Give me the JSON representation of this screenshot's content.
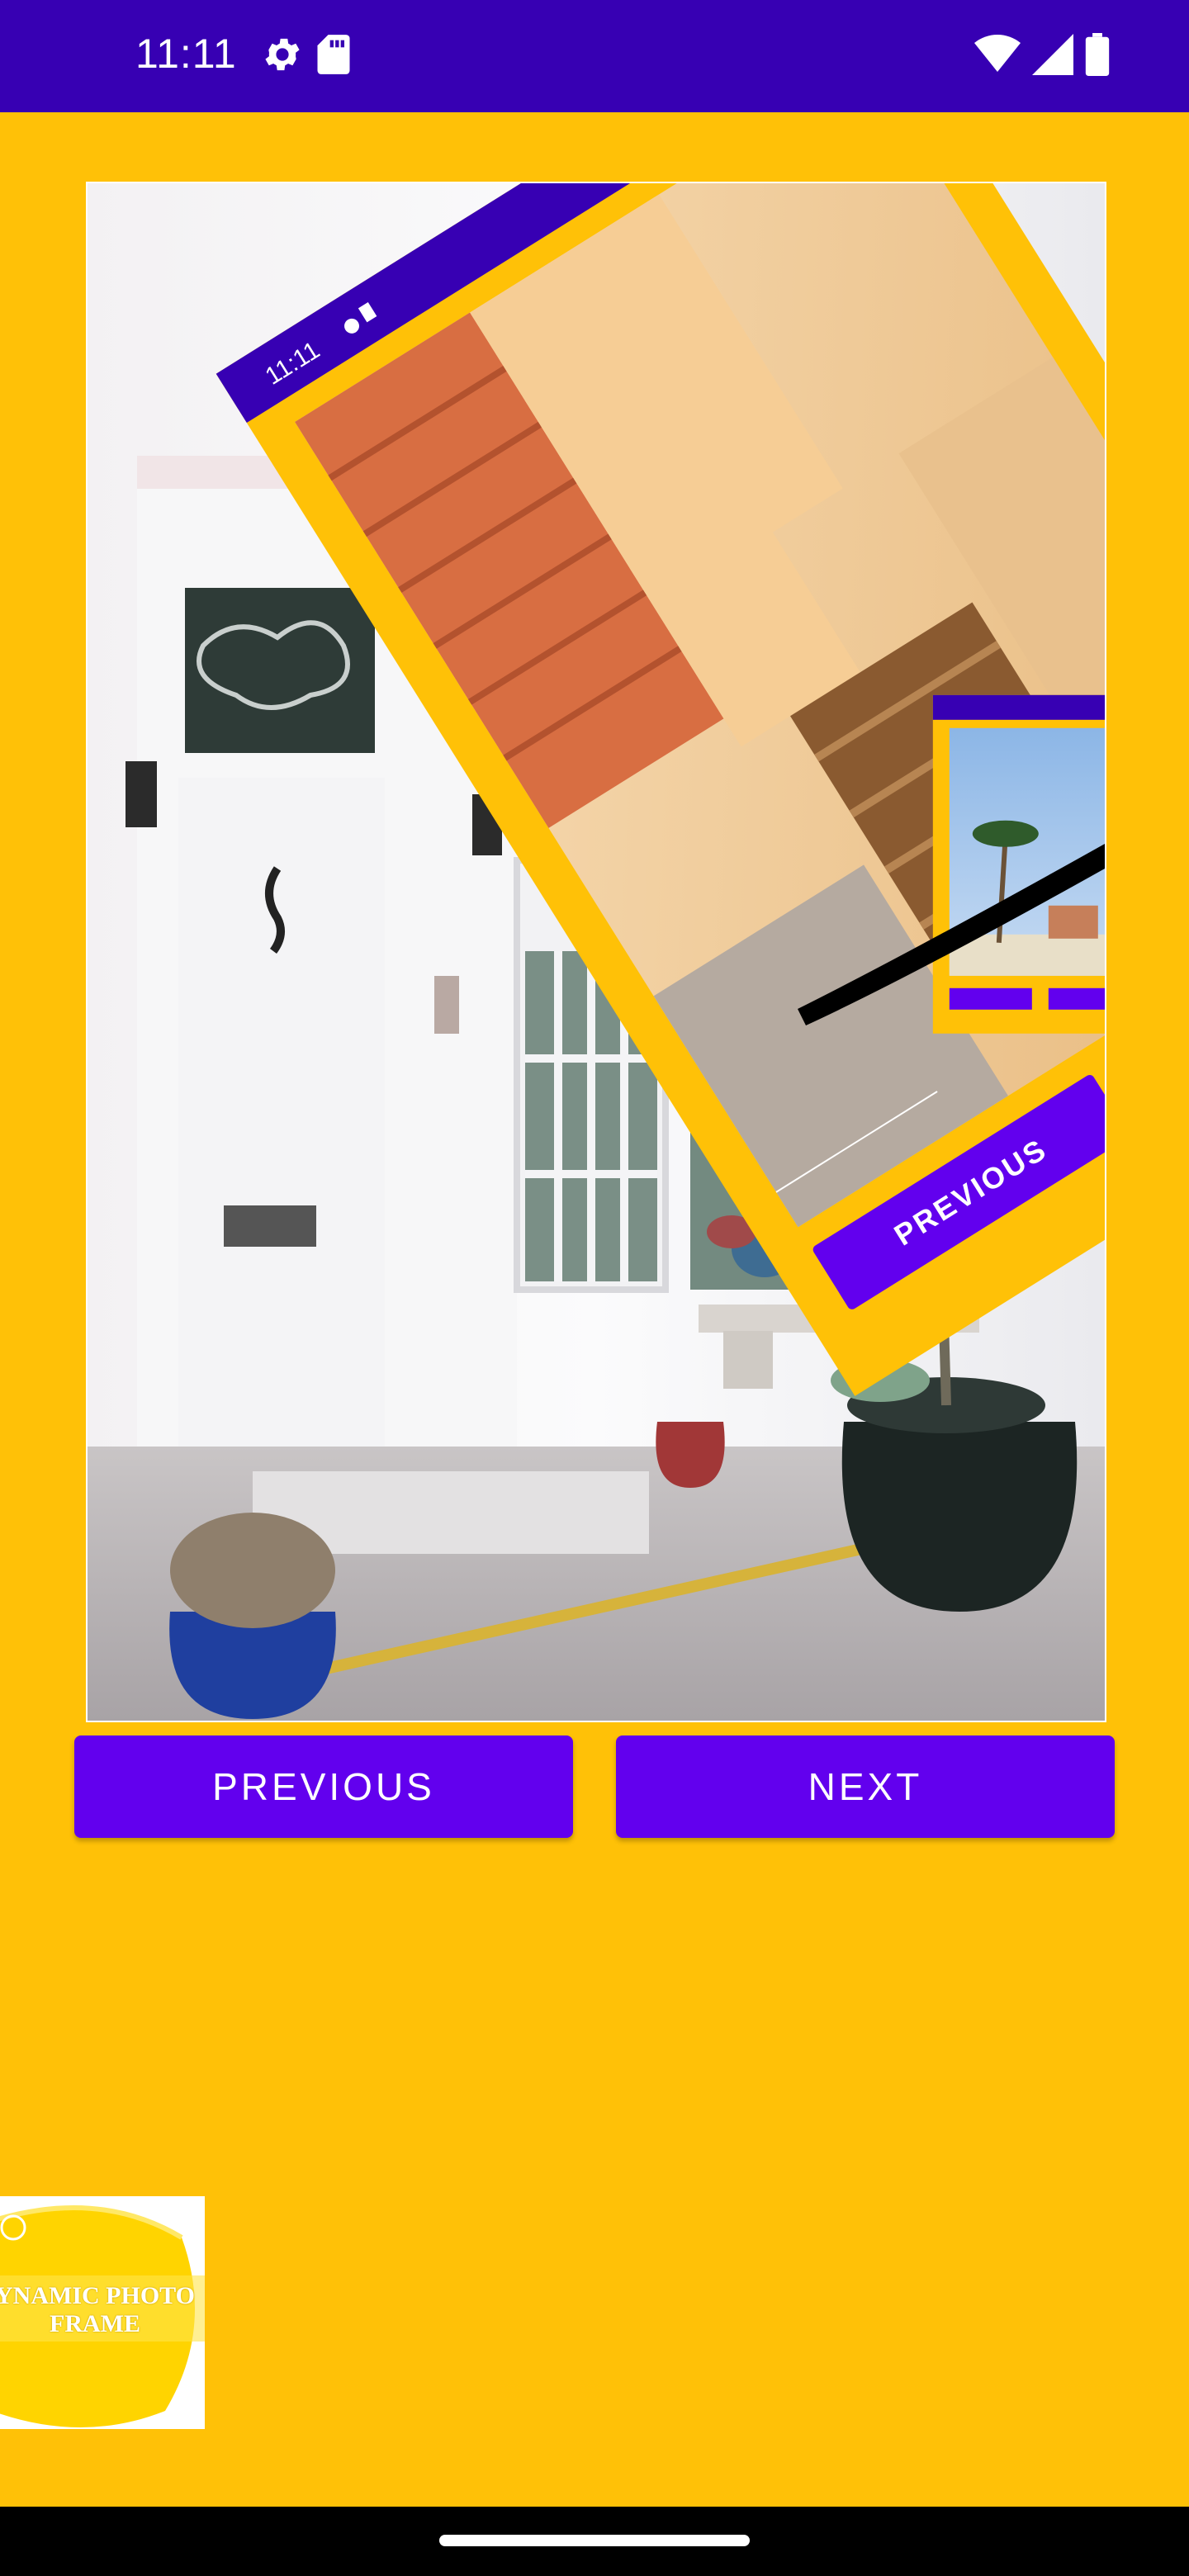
{
  "status_bar": {
    "time": "11:11",
    "left_icons": [
      "settings-icon",
      "sd-card-icon"
    ],
    "right_icons": [
      "wifi-icon",
      "signal-icon",
      "battery-icon"
    ],
    "color": "#3700B3"
  },
  "photo_frame": {
    "image": "white-house-door-photo",
    "overlay_screenshot": {
      "time": "11:11",
      "button_label": "PREVIOUS"
    }
  },
  "buttons": {
    "previous_label": "PREVIOUS",
    "next_label": "NEXT",
    "color": "#6200EE"
  },
  "app_badge": {
    "line1": "YNAMIC PHOTO",
    "line2": "FRAME"
  },
  "theme": {
    "background": "#FFC107"
  }
}
